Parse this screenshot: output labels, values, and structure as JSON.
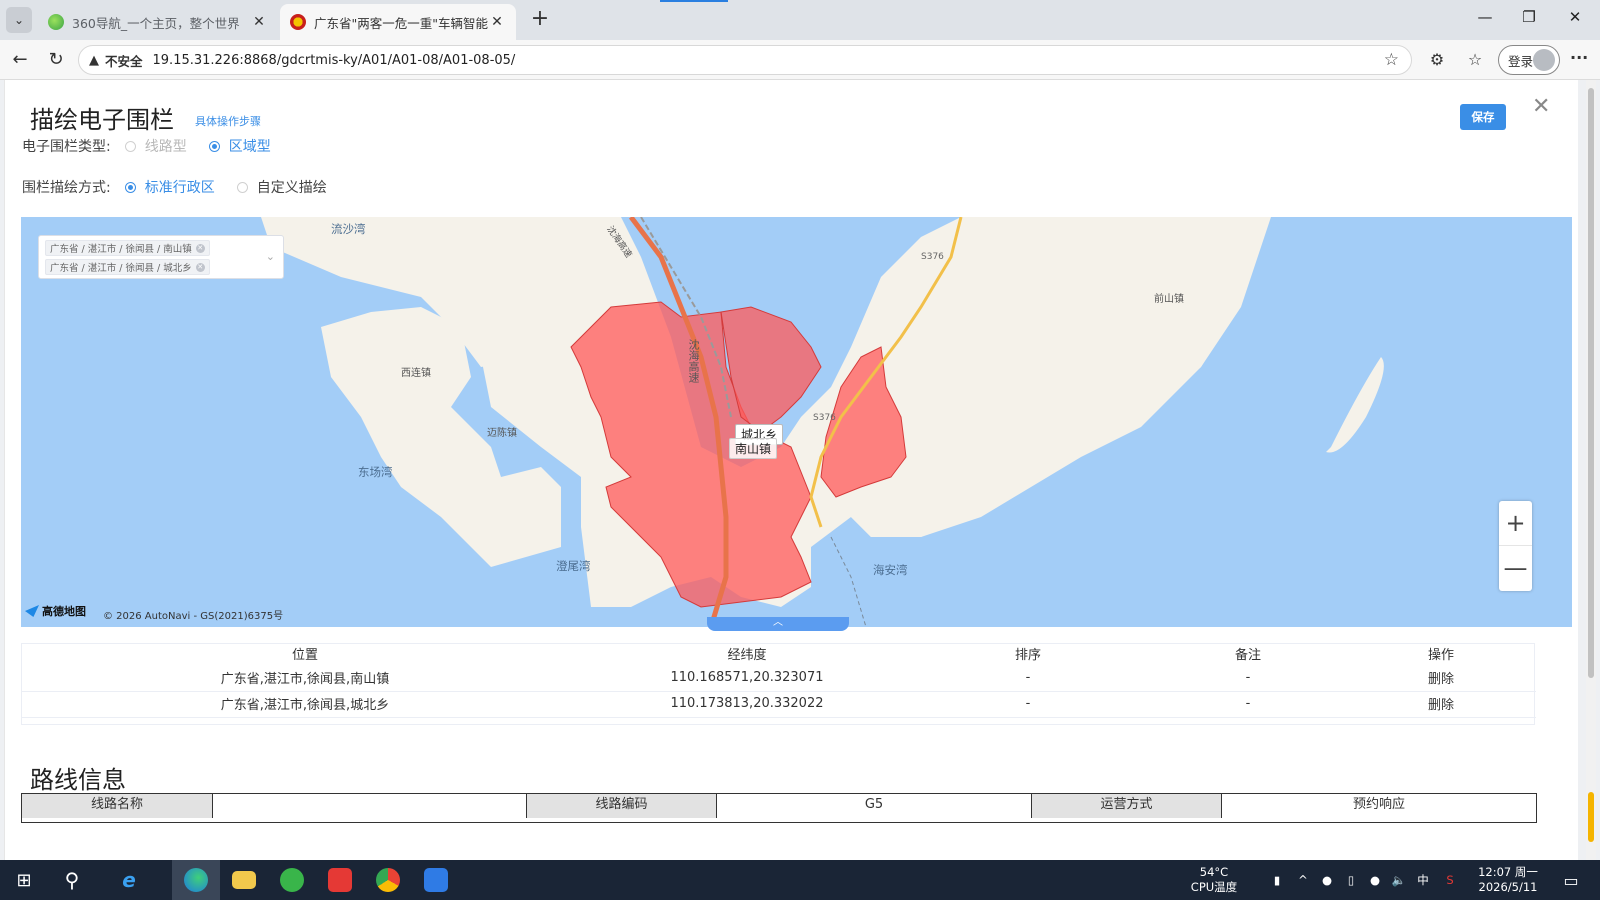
{
  "browser": {
    "tabs": [
      {
        "title": "360导航_一个主页，整个世界",
        "active": false
      },
      {
        "title": "广东省\"两客一危一重\"车辆智能监管",
        "active": true
      }
    ],
    "security_label": "不安全",
    "url": "19.15.31.226:8868/gdcrtmis-ky/A01/A01-08/A01-08-05/",
    "login_label": "登录"
  },
  "dialog": {
    "title": "描绘电子围栏",
    "steps_link": "具体操作步骤",
    "save_label": "保存",
    "fence_type": {
      "label": "电子围栏类型:",
      "options": [
        {
          "label": "线路型",
          "state": "disabled"
        },
        {
          "label": "区域型",
          "state": "selected"
        }
      ]
    },
    "draw_mode": {
      "label": "围栏描绘方式:",
      "options": [
        {
          "label": "标准行政区",
          "state": "selected"
        },
        {
          "label": "自定义描绘",
          "state": "unselected"
        }
      ]
    }
  },
  "map": {
    "selected_regions": [
      "广东省 / 湛江市 / 徐闻县 / 南山镇",
      "广东省 / 湛江市 / 徐闻县 / 城北乡"
    ],
    "places": {
      "liushawan": "流沙湾",
      "xilian": "西连镇",
      "maichen": "迈陈镇",
      "dongchangwan": "东场湾",
      "luoweiwan": "澄尾湾",
      "haianwan": "海安湾",
      "qianshan": "前山镇",
      "s376_top": "S376",
      "s376_mid": "S376",
      "highway": "沈海高速",
      "highway_top": "沈海高速"
    },
    "region_labels": {
      "chengbei": "城北乡",
      "nanshan": "南山镇"
    },
    "logo_text": "高德地图",
    "copyright": "© 2026 AutoNavi - GS(2021)6375号",
    "fence_color": "#ff5a5a",
    "zoom_in": "+",
    "zoom_out": "—"
  },
  "fence_table": {
    "headers": [
      "位置",
      "经纬度",
      "排序",
      "备注",
      "操作"
    ],
    "rows": [
      {
        "location": "广东省,湛江市,徐闻县,南山镇",
        "coords": "110.168571,20.323071",
        "order": "-",
        "remark": "-",
        "action": "删除"
      },
      {
        "location": "广东省,湛江市,徐闻县,城北乡",
        "coords": "110.173813,20.332022",
        "order": "-",
        "remark": "-",
        "action": "删除"
      }
    ]
  },
  "route": {
    "title": "路线信息",
    "cells": [
      "线路名称",
      "",
      "线路编码",
      "G5",
      "运营方式",
      "预约响应"
    ]
  },
  "taskbar": {
    "temp": "54°C",
    "temp_label": "CPU温度",
    "ime": "中",
    "time": "12:07 周一",
    "date": "2026/5/11"
  }
}
